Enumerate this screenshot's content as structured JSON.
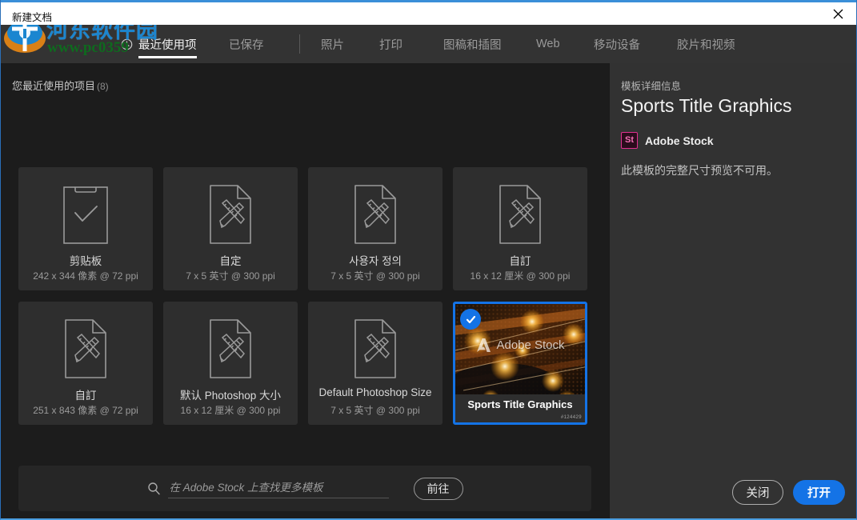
{
  "window": {
    "title": "新建文档",
    "close_icon": "close-icon"
  },
  "watermark": {
    "site_cn": "河东软件园",
    "site_url": "www.pc0359"
  },
  "tabs": [
    {
      "label": "最近使用项",
      "active": true,
      "icon": "clock-icon"
    },
    {
      "label": "已保存",
      "active": false
    },
    {
      "sep": true
    },
    {
      "label": "照片",
      "active": false
    },
    {
      "label": "打印",
      "active": false
    },
    {
      "label": "图稿和插图",
      "active": false
    },
    {
      "label": "Web",
      "active": false
    },
    {
      "label": "移动设备",
      "active": false
    },
    {
      "label": "胶片和视频",
      "active": false
    }
  ],
  "main": {
    "section_title": "您最近使用的项目",
    "section_count": "(8)",
    "cards": [
      {
        "title": "剪贴板",
        "sub": "242 x 344 像素 @ 72 ppi",
        "icon": "clipboard-check-icon",
        "selected": false
      },
      {
        "title": "自定",
        "sub": "7 x 5 英寸 @ 300 ppi",
        "icon": "document-tools-icon",
        "selected": false
      },
      {
        "title": "사용자 정의",
        "sub": "7 x 5 英寸 @ 300 ppi",
        "icon": "document-tools-icon",
        "selected": false
      },
      {
        "title": "自訂",
        "sub": "16 x 12 厘米 @ 300 ppi",
        "icon": "document-tools-icon",
        "selected": false
      },
      {
        "title": "自訂",
        "sub": "251 x 843 像素 @ 72 ppi",
        "icon": "document-tools-icon",
        "selected": false
      },
      {
        "title": "默认 Photoshop 大小",
        "sub": "16 x 12 厘米 @ 300 ppi",
        "icon": "document-tools-icon",
        "selected": false
      },
      {
        "title": "Default Photoshop Size",
        "sub": "7 x 5 英寸 @ 300 ppi",
        "icon": "document-tools-icon",
        "selected": false
      },
      {
        "title": "Sports Title Graphics",
        "sub": "",
        "icon": "template-thumbnail",
        "selected": true,
        "thumb_overlay": "Adobe Stock",
        "thumb_credit": "#124429"
      }
    ]
  },
  "search": {
    "icon": "search-icon",
    "value": "",
    "placeholder": "在 Adobe Stock 上查找更多模板",
    "go_label": "前往"
  },
  "details": {
    "label": "模板详细信息",
    "title": "Sports Title Graphics",
    "badge_text": "St",
    "source": "Adobe Stock",
    "note": "此模板的完整尺寸预览不可用。"
  },
  "footer": {
    "close_label": "关闭",
    "open_label": "打开"
  },
  "colors": {
    "accent": "#1473e6",
    "panel_bg": "#323232",
    "main_bg": "#1c1c1c",
    "tabbar_bg": "#333333",
    "card_bg": "#2e2e2e",
    "stock_badge": "#e1308f"
  }
}
